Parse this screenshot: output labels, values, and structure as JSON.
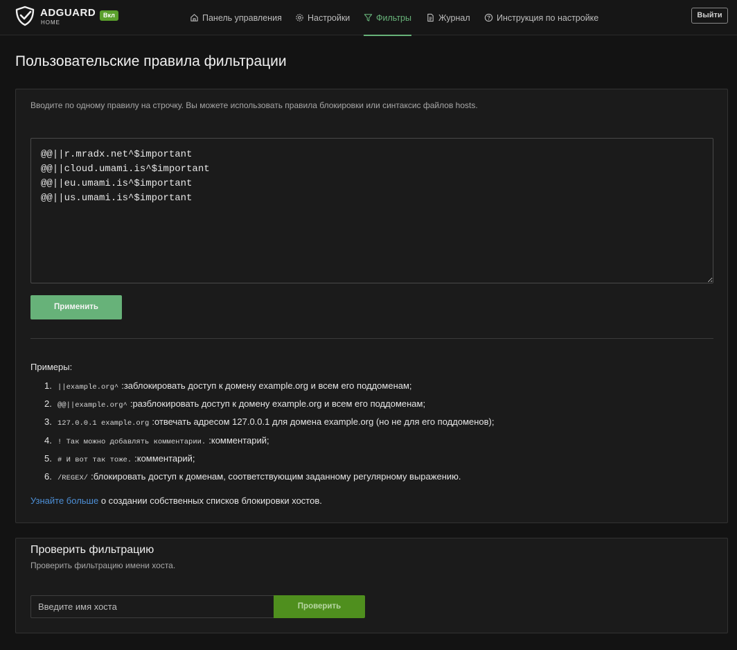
{
  "header": {
    "brand": "ADGUARD",
    "brand_sub": "HOME",
    "status_badge": "Вкл",
    "nav": [
      {
        "label": "Панель управления",
        "icon": "home-icon"
      },
      {
        "label": "Настройки",
        "icon": "gear-icon"
      },
      {
        "label": "Фильтры",
        "icon": "filter-icon",
        "active": true
      },
      {
        "label": "Журнал",
        "icon": "document-icon"
      },
      {
        "label": "Инструкция по настройке",
        "icon": "help-circle-icon"
      }
    ],
    "logout_label": "Выйти"
  },
  "page": {
    "title": "Пользовательские правила фильтрации"
  },
  "rules_card": {
    "hint": "Вводите по одному правилу на строчку. Вы можете использовать правила блокировки или синтаксис файлов hosts.",
    "rules_text": "@@||r.mradx.net^$important\n@@||cloud.umami.is^$important\n@@||eu.umami.is^$important\n@@||us.umami.is^$important",
    "apply_label": "Применить",
    "examples_title": "Примеры:",
    "examples": [
      {
        "num": "1.",
        "code": "||example.org^",
        "text": ":заблокировать доступ к домену example.org и всем его поддоменам;"
      },
      {
        "num": "2.",
        "code": "@@||example.org^",
        "text": ":разблокировать доступ к домену example.org и всем его поддоменам;"
      },
      {
        "num": "3.",
        "code": "127.0.0.1 example.org",
        "text": ":отвечать адресом 127.0.0.1 для домена example.org (но не для его поддоменов);"
      },
      {
        "num": "4.",
        "code": "! Так можно добавлять комментарии.",
        "text": ":комментарий;"
      },
      {
        "num": "5.",
        "code": "# И вот так тоже.",
        "text": ":комментарий;"
      },
      {
        "num": "6.",
        "code": "/REGEX/",
        "text": ":блокировать доступ к доменам, соответствующим заданному регулярному выражению."
      }
    ],
    "learn_more_link": "Узнайте больше",
    "learn_more_text": " о создании собственных списков блокировки хостов."
  },
  "check_card": {
    "title": "Проверить фильтрацию",
    "subtitle": "Проверить фильтрацию имени хоста.",
    "input_placeholder": "Введите имя хоста",
    "check_label": "Проверить"
  },
  "colors": {
    "accent": "#67b279",
    "badge": "#5aa02c",
    "link": "#4d8fd6",
    "background": "#131313"
  }
}
